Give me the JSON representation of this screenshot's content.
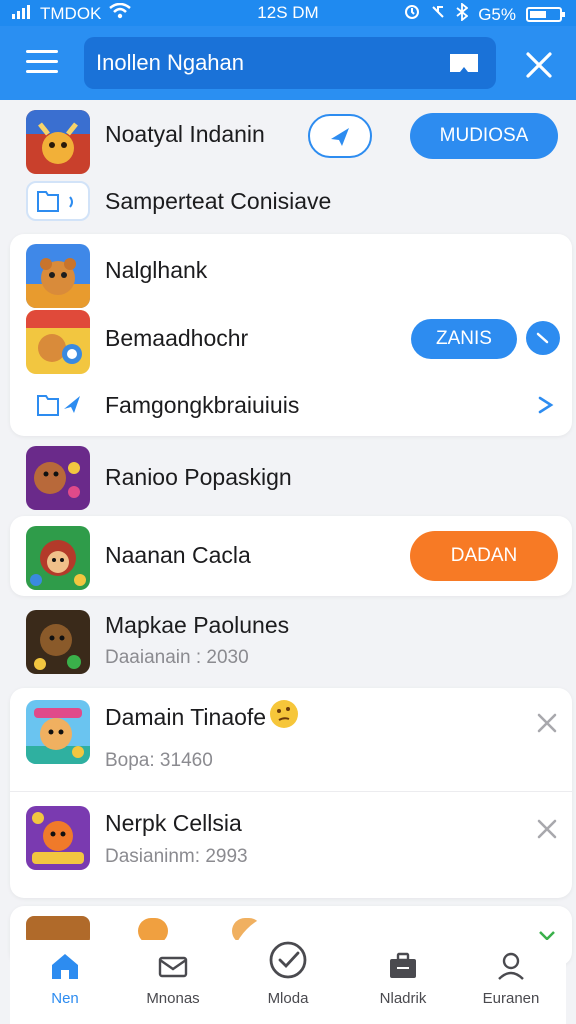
{
  "status": {
    "carrier": "TMDOK",
    "time": "12S DM",
    "battery": "G5%"
  },
  "header": {
    "search_value": "Inollen Ngahan"
  },
  "items": [
    {
      "title": "Noatyal Indanin",
      "button": "MUDIOSA"
    },
    {
      "title": "Samperteat Conisiave"
    },
    {
      "title": "Nalglhank"
    },
    {
      "title": "Bemaadhochr",
      "button": "ZANIS"
    },
    {
      "title": "Famgongkbraiuiuis"
    },
    {
      "title": "Ranioo Popaskign"
    },
    {
      "title": "Naanan Cacla",
      "button": "DADAN"
    },
    {
      "title": "Mapkae Paolunes",
      "sub": "Daaianain : 2030"
    },
    {
      "title": "Damain Tinaofe",
      "sub": "Bopa: 31460"
    },
    {
      "title": "Nerpk Cellsia",
      "sub": "Dasianinm: 2993"
    }
  ],
  "nav": [
    {
      "label": "Nen"
    },
    {
      "label": "Mnonas"
    },
    {
      "label": "Mloda"
    },
    {
      "label": "Nladrik"
    },
    {
      "label": "Euranen"
    }
  ],
  "colors": {
    "primary": "#2d8cf0",
    "header": "#2a8ff2",
    "orange": "#f77a25",
    "background": "#f2f3f6"
  }
}
